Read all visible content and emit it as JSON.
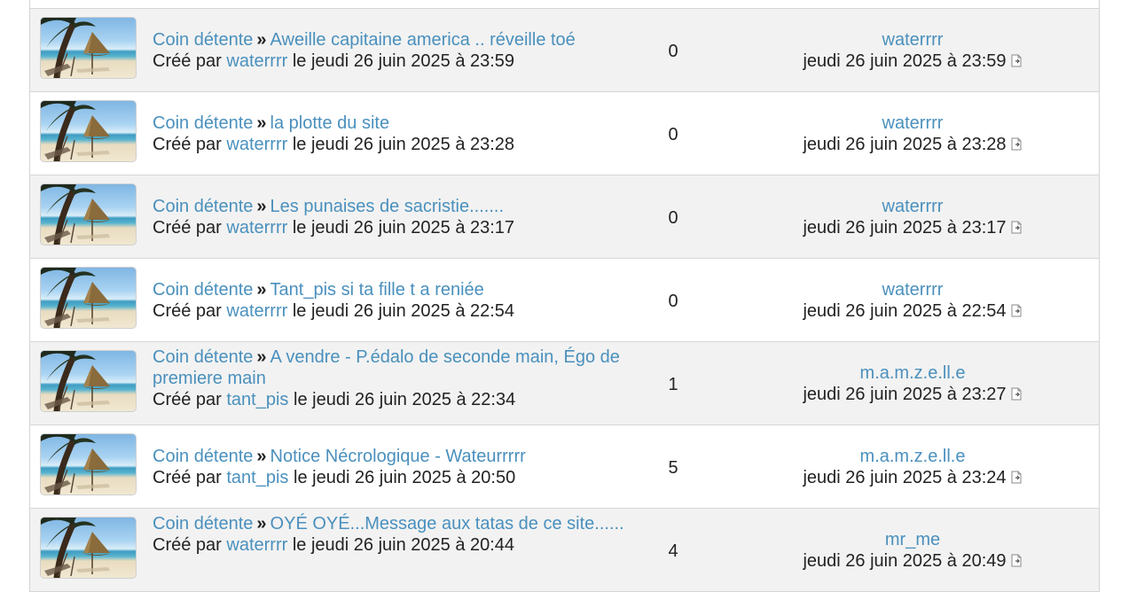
{
  "forum": "Coin détente",
  "created_by_label": "Créé par",
  "date_prefix": "le",
  "topics": [
    {
      "title": "",
      "author": "",
      "created": "",
      "replies": "",
      "last_user": "",
      "last_date": ""
    },
    {
      "title": "Aweille capitaine america .. réveille toé",
      "author": "waterrrr",
      "created": "jeudi 26 juin 2025 à 23:59",
      "replies": "0",
      "last_user": "waterrrr",
      "last_date": "jeudi 26 juin 2025 à 23:59"
    },
    {
      "title": "la plotte du site",
      "author": "waterrrr",
      "created": "jeudi 26 juin 2025 à 23:28",
      "replies": "0",
      "last_user": "waterrrr",
      "last_date": "jeudi 26 juin 2025 à 23:28"
    },
    {
      "title": "Les punaises de sacristie.......",
      "author": "waterrrr",
      "created": "jeudi 26 juin 2025 à 23:17",
      "replies": "0",
      "last_user": "waterrrr",
      "last_date": "jeudi 26 juin 2025 à 23:17"
    },
    {
      "title": "Tant_pis si ta fille t a reniée",
      "author": "waterrrr",
      "created": "jeudi 26 juin 2025 à 22:54",
      "replies": "0",
      "last_user": "waterrrr",
      "last_date": "jeudi 26 juin 2025 à 22:54"
    },
    {
      "title": "A vendre - P.édalo de seconde main, Égo de premiere main",
      "author": "tant_pis",
      "created": "jeudi 26 juin 2025 à 22:34",
      "replies": "1",
      "last_user": "m.a.m.z.e.ll.e",
      "last_date": "jeudi 26 juin 2025 à 23:27"
    },
    {
      "title": "Notice Nécrologique - Wateurrrrr",
      "author": "tant_pis",
      "created": "jeudi 26 juin 2025 à 20:50",
      "replies": "5",
      "last_user": "m.a.m.z.e.ll.e",
      "last_date": "jeudi 26 juin 2025 à 23:24"
    },
    {
      "title": "OYÉ OYÉ...Message aux tatas de ce site......",
      "author": "waterrrr",
      "created": "jeudi 26 juin 2025 à 20:44",
      "replies": "4",
      "last_user": "mr_me",
      "last_date": "jeudi 26 juin 2025 à 20:49"
    }
  ]
}
